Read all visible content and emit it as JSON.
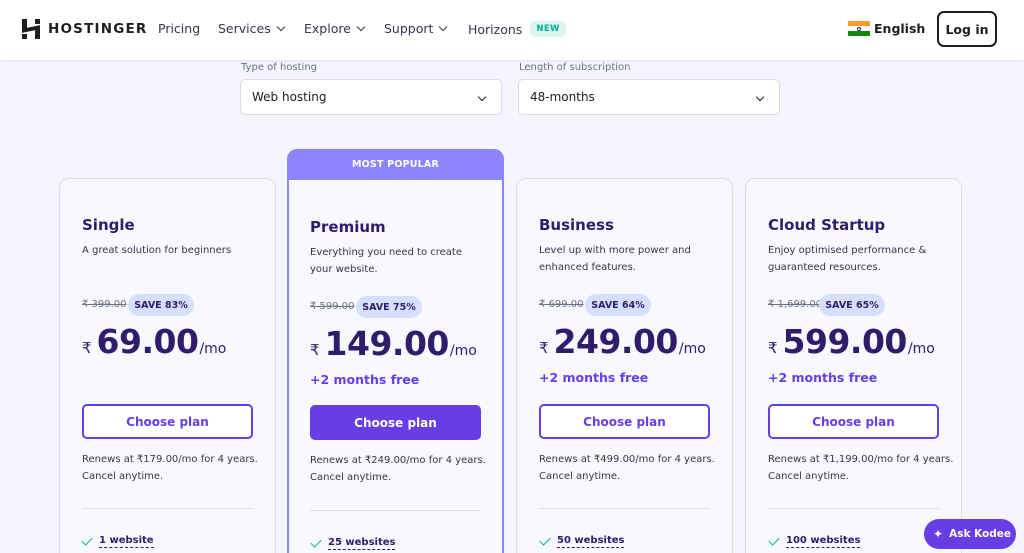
{
  "header": {
    "brand": "HOSTINGER",
    "nav": [
      {
        "label": "Pricing",
        "dropdown": false
      },
      {
        "label": "Services",
        "dropdown": true
      },
      {
        "label": "Explore",
        "dropdown": true
      },
      {
        "label": "Support",
        "dropdown": true
      },
      {
        "label": "Horizons",
        "dropdown": false,
        "badge": "NEW"
      }
    ],
    "language": "English",
    "login_label": "Log in"
  },
  "filters": {
    "hosting_label": "Type of hosting",
    "hosting_value": "Web hosting",
    "length_label": "Length of subscription",
    "length_value": "48-months"
  },
  "popular_label": "MOST POPULAR",
  "plans": [
    {
      "name": "Single",
      "description": "A great solution for beginners",
      "old_price": "₹ 399.00",
      "save": "SAVE 83%",
      "currency": "₹",
      "price": "69.00",
      "per": "/mo",
      "bonus": "",
      "button": "Choose plan",
      "renew_line1": "Renews at ₹179.00/mo for 4 years.",
      "renew_line2": "Cancel anytime.",
      "feature_num": "1",
      "feature_text": "website"
    },
    {
      "name": "Premium",
      "description": "Everything you need to create your website.",
      "old_price": "₹ 599.00",
      "save": "SAVE 75%",
      "currency": "₹",
      "price": "149.00",
      "per": "/mo",
      "bonus": "+2 months free",
      "button": "Choose plan",
      "renew_line1": "Renews at ₹249.00/mo for 4 years.",
      "renew_line2": "Cancel anytime.",
      "feature_num": "25",
      "feature_text": "websites"
    },
    {
      "name": "Business",
      "description": "Level up with more power and enhanced features.",
      "old_price": "₹ 699.00",
      "save": "SAVE 64%",
      "currency": "₹",
      "price": "249.00",
      "per": "/mo",
      "bonus": "+2 months free",
      "button": "Choose plan",
      "renew_line1": "Renews at ₹499.00/mo for 4 years.",
      "renew_line2": "Cancel anytime.",
      "feature_num": "50",
      "feature_text": "websites"
    },
    {
      "name": "Cloud Startup",
      "description": "Enjoy optimised performance & guaranteed resources.",
      "old_price": "₹ 1,699.00",
      "save": "SAVE 65%",
      "currency": "₹",
      "price": "599.00",
      "per": "/mo",
      "bonus": "+2 months free",
      "button": "Choose plan",
      "renew_line1": "Renews at ₹1,199.00/mo for 4 years.",
      "renew_line2": "Cancel anytime.",
      "feature_num": "100",
      "feature_text": "websites"
    }
  ],
  "assistant_label": "Ask Kodee",
  "colors": {
    "brand": "#673de6",
    "popular": "#8c85ff",
    "check": "#00b090",
    "text": "#2f1c6a"
  }
}
